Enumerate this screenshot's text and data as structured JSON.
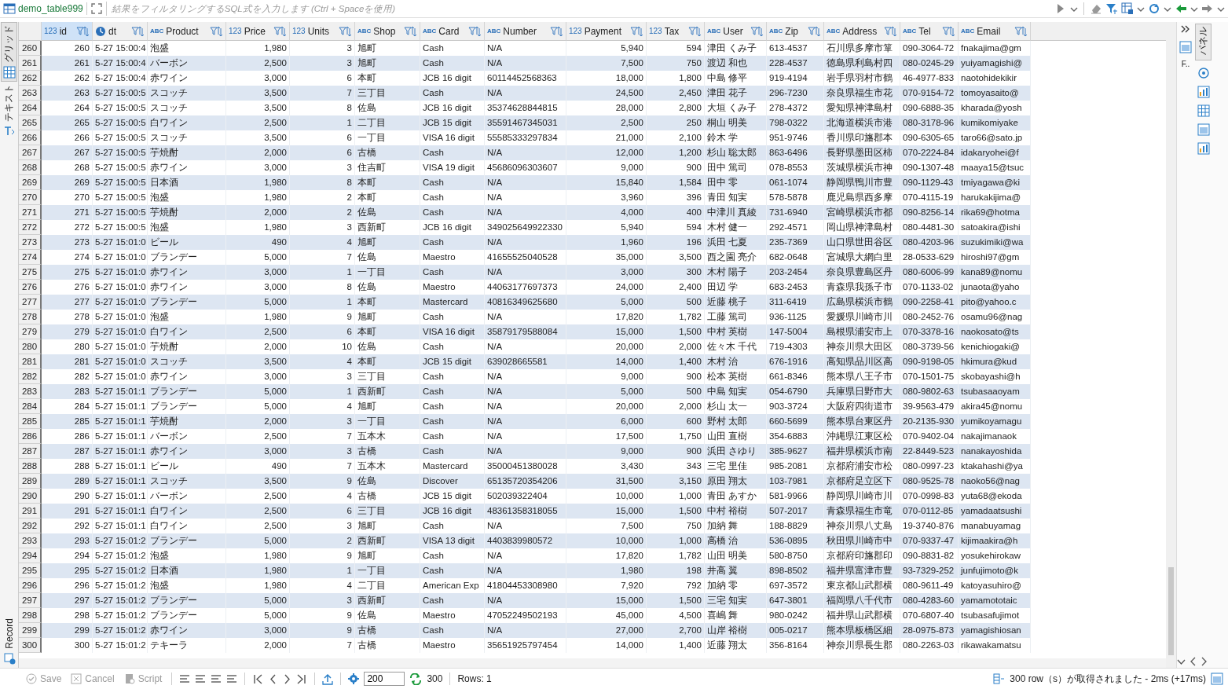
{
  "editor_tab": {
    "title": "demo_table999"
  },
  "filter": {
    "placeholder": "結果をフィルタリングするSQL式を入力します (Ctrl + Spaceを使用)"
  },
  "left_tabs": [
    {
      "label": "グリッド",
      "selected": true
    },
    {
      "label": "テキスト",
      "selected": false
    }
  ],
  "record_tab": {
    "label": "Record"
  },
  "right_panel": {
    "label": "パネル",
    "short_label": "F.."
  },
  "table": {
    "columns": [
      {
        "name": "id",
        "kind": "number",
        "badge": "123",
        "selected": true
      },
      {
        "name": "dt",
        "kind": "datetime",
        "selected": false
      },
      {
        "name": "Product",
        "kind": "text",
        "badge": "ABC",
        "selected": false
      },
      {
        "name": "Price",
        "kind": "number",
        "badge": "123",
        "selected": false
      },
      {
        "name": "Units",
        "kind": "number",
        "badge": "123",
        "selected": false
      },
      {
        "name": "Shop",
        "kind": "text",
        "badge": "ABC",
        "selected": false
      },
      {
        "name": "Card",
        "kind": "text",
        "badge": "ABC",
        "selected": false
      },
      {
        "name": "Number",
        "kind": "text",
        "badge": "ABC",
        "selected": false
      },
      {
        "name": "Payment",
        "kind": "number",
        "badge": "123",
        "selected": false
      },
      {
        "name": "Tax",
        "kind": "number",
        "badge": "123",
        "selected": false
      },
      {
        "name": "User",
        "kind": "text",
        "badge": "ABC",
        "selected": false
      },
      {
        "name": "Zip",
        "kind": "text",
        "badge": "ABC",
        "selected": false
      },
      {
        "name": "Address",
        "kind": "text",
        "badge": "ABC",
        "selected": false
      },
      {
        "name": "Tel",
        "kind": "text",
        "badge": "ABC",
        "selected": false
      },
      {
        "name": "Email",
        "kind": "text",
        "badge": "ABC",
        "selected": false
      }
    ],
    "rows": [
      {
        "row_number": "260",
        "cells": [
          "260",
          "5-27 15:00:4",
          "泡盛",
          "1,980",
          "3",
          "旭町",
          "Cash",
          "N/A",
          "5,940",
          "594",
          "津田 くみ子",
          "613-4537",
          "石川県多摩市箪",
          "090-3064-72",
          "fnakajima@gm"
        ]
      },
      {
        "row_number": "261",
        "cells": [
          "261",
          "5-27 15:00:4",
          "バーボン",
          "2,500",
          "3",
          "旭町",
          "Cash",
          "N/A",
          "7,500",
          "750",
          "渡辺 和也",
          "228-4537",
          "徳島県利島村四",
          "080-0245-29",
          "yuiyamagishi@"
        ]
      },
      {
        "row_number": "262",
        "cells": [
          "262",
          "5-27 15:00:4",
          "赤ワイン",
          "3,000",
          "6",
          "本町",
          "JCB 16 digit",
          "60114452568363",
          "18,000",
          "1,800",
          "中島 修平",
          "919-4194",
          "岩手県羽村市鶴",
          "46-4977-833",
          "naotohidekikir"
        ]
      },
      {
        "row_number": "263",
        "cells": [
          "263",
          "5-27 15:00:5",
          "スコッチ",
          "3,500",
          "7",
          "三丁目",
          "Cash",
          "N/A",
          "24,500",
          "2,450",
          "津田 花子",
          "296-7230",
          "奈良県福生市花",
          "070-9154-72",
          "tomoyasaito@"
        ]
      },
      {
        "row_number": "264",
        "cells": [
          "264",
          "5-27 15:00:5",
          "スコッチ",
          "3,500",
          "8",
          "佐島",
          "JCB 16 digit",
          "35374628844815",
          "28,000",
          "2,800",
          "大垣 くみ子",
          "278-4372",
          "愛知県神津島村",
          "090-6888-35",
          "kharada@yosh"
        ]
      },
      {
        "row_number": "265",
        "cells": [
          "265",
          "5-27 15:00:5",
          "白ワイン",
          "2,500",
          "1",
          "二丁目",
          "JCB 15 digit",
          "35591467345031",
          "2,500",
          "250",
          "桐山 明美",
          "798-0322",
          "北海道横浜市港",
          "080-3178-96",
          "kumikomiyake"
        ]
      },
      {
        "row_number": "266",
        "cells": [
          "266",
          "5-27 15:00:5",
          "スコッチ",
          "3,500",
          "6",
          "一丁目",
          "VISA 16 digit",
          "55585333297834",
          "21,000",
          "2,100",
          "鈴木 学",
          "951-9746",
          "香川県印旛郡本",
          "090-6305-65",
          "taro66@sato.jp"
        ]
      },
      {
        "row_number": "267",
        "cells": [
          "267",
          "5-27 15:00:5",
          "芋焼酎",
          "2,000",
          "6",
          "古橋",
          "Cash",
          "N/A",
          "12,000",
          "1,200",
          "杉山 聡太郎",
          "863-6496",
          "長野県墨田区柿",
          "070-2224-84",
          "idakaryohei@f"
        ]
      },
      {
        "row_number": "268",
        "cells": [
          "268",
          "5-27 15:00:5",
          "赤ワイン",
          "3,000",
          "3",
          "住吉町",
          "VISA 19 digit",
          "45686096303607",
          "9,000",
          "900",
          "田中 篤司",
          "078-8553",
          "茨城県横浜市神",
          "090-1307-48",
          "maaya15@tsuc"
        ]
      },
      {
        "row_number": "269",
        "cells": [
          "269",
          "5-27 15:00:5",
          "日本酒",
          "1,980",
          "8",
          "本町",
          "Cash",
          "N/A",
          "15,840",
          "1,584",
          "田中 零",
          "061-1074",
          "静岡県鴨川市豊",
          "090-1129-43",
          "tmiyagawa@ki"
        ]
      },
      {
        "row_number": "270",
        "cells": [
          "270",
          "5-27 15:00:5",
          "泡盛",
          "1,980",
          "2",
          "本町",
          "Cash",
          "N/A",
          "3,960",
          "396",
          "青田 知実",
          "578-5878",
          "鹿児島県西多摩",
          "070-4115-19",
          "harukakijima@"
        ]
      },
      {
        "row_number": "271",
        "cells": [
          "271",
          "5-27 15:00:5",
          "芋焼酎",
          "2,000",
          "2",
          "佐島",
          "Cash",
          "N/A",
          "4,000",
          "400",
          "中津川 真綾",
          "731-6940",
          "宮崎県横浜市都",
          "090-8256-14",
          "rika69@hotma"
        ]
      },
      {
        "row_number": "272",
        "cells": [
          "272",
          "5-27 15:00:5",
          "泡盛",
          "1,980",
          "3",
          "西新町",
          "JCB 16 digit",
          "349025649922330",
          "5,940",
          "594",
          "木村 健一",
          "292-4571",
          "岡山県神津島村",
          "080-4481-30",
          "satoakira@ishi"
        ]
      },
      {
        "row_number": "273",
        "cells": [
          "273",
          "5-27 15:01:0",
          "ビール",
          "490",
          "4",
          "旭町",
          "Cash",
          "N/A",
          "1,960",
          "196",
          "浜田 七夏",
          "235-7369",
          "山口県世田谷区",
          "080-4203-96",
          "suzukimiki@wa"
        ]
      },
      {
        "row_number": "274",
        "cells": [
          "274",
          "5-27 15:01:0",
          "ブランデー",
          "5,000",
          "7",
          "佐島",
          "Maestro",
          "41655525040528",
          "35,000",
          "3,500",
          "西之園 亮介",
          "682-0648",
          "宮城県大網白里",
          "28-0533-629",
          "hiroshi97@gm"
        ]
      },
      {
        "row_number": "275",
        "cells": [
          "275",
          "5-27 15:01:0",
          "赤ワイン",
          "3,000",
          "1",
          "一丁目",
          "Cash",
          "N/A",
          "3,000",
          "300",
          "木村 陽子",
          "203-2454",
          "奈良県豊島区丹",
          "080-6006-99",
          "kana89@nomu"
        ]
      },
      {
        "row_number": "276",
        "cells": [
          "276",
          "5-27 15:01:0",
          "赤ワイン",
          "3,000",
          "8",
          "佐島",
          "Maestro",
          "44063177697373",
          "24,000",
          "2,400",
          "田辺 学",
          "683-2453",
          "青森県我孫子市",
          "070-1133-02",
          "junaota@yaho"
        ]
      },
      {
        "row_number": "277",
        "cells": [
          "277",
          "5-27 15:01:0",
          "ブランデー",
          "5,000",
          "1",
          "本町",
          "Mastercard",
          "40816349625680",
          "5,000",
          "500",
          "近藤 桃子",
          "311-6419",
          "広島県横浜市鶴",
          "090-2258-41",
          "pito@yahoo.c"
        ]
      },
      {
        "row_number": "278",
        "cells": [
          "278",
          "5-27 15:01:0",
          "泡盛",
          "1,980",
          "9",
          "旭町",
          "Cash",
          "N/A",
          "17,820",
          "1,782",
          "工藤 篤司",
          "936-1125",
          "愛媛県川崎市川",
          "080-2452-76",
          "osamu96@nag"
        ]
      },
      {
        "row_number": "279",
        "cells": [
          "279",
          "5-27 15:01:0",
          "白ワイン",
          "2,500",
          "6",
          "本町",
          "VISA 16 digit",
          "35879179588084",
          "15,000",
          "1,500",
          "中村 英樹",
          "147-5004",
          "島根県浦安市上",
          "070-3378-16",
          "naokosato@ts"
        ]
      },
      {
        "row_number": "280",
        "cells": [
          "280",
          "5-27 15:01:0",
          "芋焼酎",
          "2,000",
          "10",
          "佐島",
          "Cash",
          "N/A",
          "20,000",
          "2,000",
          "佐々木 千代",
          "719-4303",
          "神奈川県大田区",
          "080-3739-56",
          "kenichiogaki@"
        ]
      },
      {
        "row_number": "281",
        "cells": [
          "281",
          "5-27 15:01:0",
          "スコッチ",
          "3,500",
          "4",
          "本町",
          "JCB 15 digit",
          "639028665581",
          "14,000",
          "1,400",
          "木村 治",
          "676-1916",
          "高知県品川区高",
          "090-9198-05",
          "hkimura@kud"
        ]
      },
      {
        "row_number": "282",
        "cells": [
          "282",
          "5-27 15:01:0",
          "赤ワイン",
          "3,000",
          "3",
          "三丁目",
          "Cash",
          "N/A",
          "9,000",
          "900",
          "松本 英樹",
          "661-8346",
          "熊本県八王子市",
          "070-1501-75",
          "skobayashi@h"
        ]
      },
      {
        "row_number": "283",
        "cells": [
          "283",
          "5-27 15:01:1",
          "ブランデー",
          "5,000",
          "1",
          "西新町",
          "Cash",
          "N/A",
          "5,000",
          "500",
          "中島 知実",
          "054-6790",
          "兵庫県日野市大",
          "080-9802-63",
          "tsubasaaoyam"
        ]
      },
      {
        "row_number": "284",
        "cells": [
          "284",
          "5-27 15:01:1",
          "ブランデー",
          "5,000",
          "4",
          "旭町",
          "Cash",
          "N/A",
          "20,000",
          "2,000",
          "杉山 太一",
          "903-3724",
          "大阪府四街道市",
          "39-9563-479",
          "akira45@nomu"
        ]
      },
      {
        "row_number": "285",
        "cells": [
          "285",
          "5-27 15:01:1",
          "芋焼酎",
          "2,000",
          "3",
          "一丁目",
          "Cash",
          "N/A",
          "6,000",
          "600",
          "野村 太郎",
          "660-5699",
          "熊本県台東区丹",
          "20-2135-930",
          "yumikoyamagu"
        ]
      },
      {
        "row_number": "286",
        "cells": [
          "286",
          "5-27 15:01:1",
          "バーボン",
          "2,500",
          "7",
          "五本木",
          "Cash",
          "N/A",
          "17,500",
          "1,750",
          "山田 直樹",
          "354-6883",
          "沖縄県江東区松",
          "070-9402-04",
          "nakajimanaok"
        ]
      },
      {
        "row_number": "287",
        "cells": [
          "287",
          "5-27 15:01:1",
          "赤ワイン",
          "3,000",
          "3",
          "古橋",
          "Cash",
          "N/A",
          "9,000",
          "900",
          "浜田 さゆり",
          "385-9627",
          "福井県横浜市南",
          "22-8449-523",
          "nanakayoshida"
        ]
      },
      {
        "row_number": "288",
        "cells": [
          "288",
          "5-27 15:01:1",
          "ビール",
          "490",
          "7",
          "五本木",
          "Mastercard",
          "35000451380028",
          "3,430",
          "343",
          "三宅 里佳",
          "985-2081",
          "京都府浦安市松",
          "080-0997-23",
          "ktakahashi@ya"
        ]
      },
      {
        "row_number": "289",
        "cells": [
          "289",
          "5-27 15:01:1",
          "スコッチ",
          "3,500",
          "9",
          "佐島",
          "Discover",
          "65135720354206",
          "31,500",
          "3,150",
          "原田 翔太",
          "103-7981",
          "京都府足立区下",
          "080-9525-78",
          "naoko56@nag"
        ]
      },
      {
        "row_number": "290",
        "cells": [
          "290",
          "5-27 15:01:1",
          "バーボン",
          "2,500",
          "4",
          "古橋",
          "JCB 15 digit",
          "502039322404",
          "10,000",
          "1,000",
          "青田 あすか",
          "581-9966",
          "静岡県川崎市川",
          "070-0998-83",
          "yuta68@ekoda"
        ]
      },
      {
        "row_number": "291",
        "cells": [
          "291",
          "5-27 15:01:1",
          "白ワイン",
          "2,500",
          "6",
          "三丁目",
          "JCB 16 digit",
          "48361358318055",
          "15,000",
          "1,500",
          "中村 裕樹",
          "507-2017",
          "青森県福生市竜",
          "070-0112-85",
          "yamadaatsushi"
        ]
      },
      {
        "row_number": "292",
        "cells": [
          "292",
          "5-27 15:01:1",
          "白ワイン",
          "2,500",
          "3",
          "旭町",
          "Cash",
          "N/A",
          "7,500",
          "750",
          "加納 舞",
          "188-8829",
          "神奈川県八丈島",
          "19-3740-876",
          "manabuyamag"
        ]
      },
      {
        "row_number": "293",
        "cells": [
          "293",
          "5-27 15:01:2",
          "ブランデー",
          "5,000",
          "2",
          "西新町",
          "VISA 13 digit",
          "4403839980572",
          "10,000",
          "1,000",
          "高橋 治",
          "536-0895",
          "秋田県川崎市中",
          "070-9337-47",
          "kijimaakira@h"
        ]
      },
      {
        "row_number": "294",
        "cells": [
          "294",
          "5-27 15:01:2",
          "泡盛",
          "1,980",
          "9",
          "旭町",
          "Cash",
          "N/A",
          "17,820",
          "1,782",
          "山田 明美",
          "580-8750",
          "京都府印旛郡印",
          "090-8831-82",
          "yosukehirokaw"
        ]
      },
      {
        "row_number": "295",
        "cells": [
          "295",
          "5-27 15:01:2",
          "日本酒",
          "1,980",
          "1",
          "一丁目",
          "Cash",
          "N/A",
          "1,980",
          "198",
          "井高 翼",
          "898-8502",
          "福井県富津市豊",
          "93-7329-252",
          "junfujimoto@k"
        ]
      },
      {
        "row_number": "296",
        "cells": [
          "296",
          "5-27 15:01:2",
          "泡盛",
          "1,980",
          "4",
          "二丁目",
          "American Exp",
          "41804453308980",
          "7,920",
          "792",
          "加納 零",
          "697-3572",
          "東京都山武郡横",
          "080-9611-49",
          "katoyasuhiro@"
        ]
      },
      {
        "row_number": "297",
        "cells": [
          "297",
          "5-27 15:01:2",
          "ブランデー",
          "5,000",
          "3",
          "西新町",
          "Cash",
          "N/A",
          "15,000",
          "1,500",
          "三宅 知実",
          "647-3801",
          "福岡県八千代市",
          "080-4283-60",
          "yamamototaic"
        ]
      },
      {
        "row_number": "298",
        "cells": [
          "298",
          "5-27 15:01:2",
          "ブランデー",
          "5,000",
          "9",
          "佐島",
          "Maestro",
          "47052249502193",
          "45,000",
          "4,500",
          "喜嶋 舞",
          "980-0242",
          "福井県山武郡横",
          "070-6807-40",
          "tsubasafujimot"
        ]
      },
      {
        "row_number": "299",
        "cells": [
          "299",
          "5-27 15:01:2",
          "赤ワイン",
          "3,000",
          "9",
          "古橋",
          "Cash",
          "N/A",
          "27,000",
          "2,700",
          "山岸 裕樹",
          "005-0217",
          "熊本県板橋区細",
          "28-0975-873",
          "yamagishiosan"
        ]
      },
      {
        "row_number": "300",
        "cells": [
          "300",
          "5-27 15:01:2",
          "テキーラ",
          "2,000",
          "7",
          "古橋",
          "Maestro",
          "35651925797454",
          "14,000",
          "1,400",
          "近藤 翔太",
          "356-8164",
          "神奈川県長生郡",
          "080-2263-03",
          "rikawakamatsu"
        ]
      }
    ]
  },
  "bottom_bar": {
    "actions": [
      {
        "label": "Save",
        "kind": "save",
        "disabled": true
      },
      {
        "label": "Cancel",
        "kind": "cancel",
        "disabled": true
      },
      {
        "label": "Script",
        "kind": "script",
        "disabled": true
      }
    ],
    "fetch_size": "200",
    "total": "300",
    "rows_label": "Rows: 1",
    "status": "300 row（s）が取得されました - 2ms (+17ms)"
  }
}
